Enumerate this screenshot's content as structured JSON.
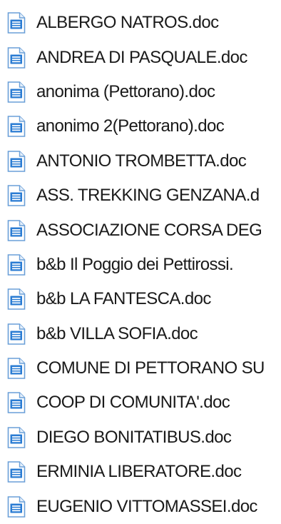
{
  "files": [
    {
      "name": "ALBERGO NATROS.doc",
      "icon": "word-document-icon"
    },
    {
      "name": "ANDREA DI PASQUALE.doc",
      "icon": "word-document-icon"
    },
    {
      "name": "anonima (Pettorano).doc",
      "icon": "word-document-icon"
    },
    {
      "name": "anonimo 2(Pettorano).doc",
      "icon": "word-document-icon"
    },
    {
      "name": "ANTONIO TROMBETTA.doc",
      "icon": "word-document-icon"
    },
    {
      "name": "ASS. TREKKING GENZANA.d",
      "icon": "word-document-icon"
    },
    {
      "name": "ASSOCIAZIONE CORSA DEG",
      "icon": "word-document-icon"
    },
    {
      "name": "b&b Il Poggio dei Pettirossi.",
      "icon": "word-document-icon"
    },
    {
      "name": "b&b LA FANTESCA.doc",
      "icon": "word-document-icon"
    },
    {
      "name": "b&b VILLA SOFIA.doc",
      "icon": "word-document-icon"
    },
    {
      "name": "COMUNE DI PETTORANO SU",
      "icon": "word-document-icon"
    },
    {
      "name": "COOP DI COMUNITA'.doc",
      "icon": "word-document-icon"
    },
    {
      "name": "DIEGO BONITATIBUS.doc",
      "icon": "word-document-icon"
    },
    {
      "name": "ERMINIA LIBERATORE.doc",
      "icon": "word-document-icon"
    },
    {
      "name": "EUGENIO VITTOMASSEI.doc",
      "icon": "word-document-icon"
    }
  ],
  "colors": {
    "icon_blue": "#2b7cd3",
    "icon_border": "#6a9fd8",
    "icon_fill": "#ffffff",
    "text": "#1a1a1a"
  }
}
